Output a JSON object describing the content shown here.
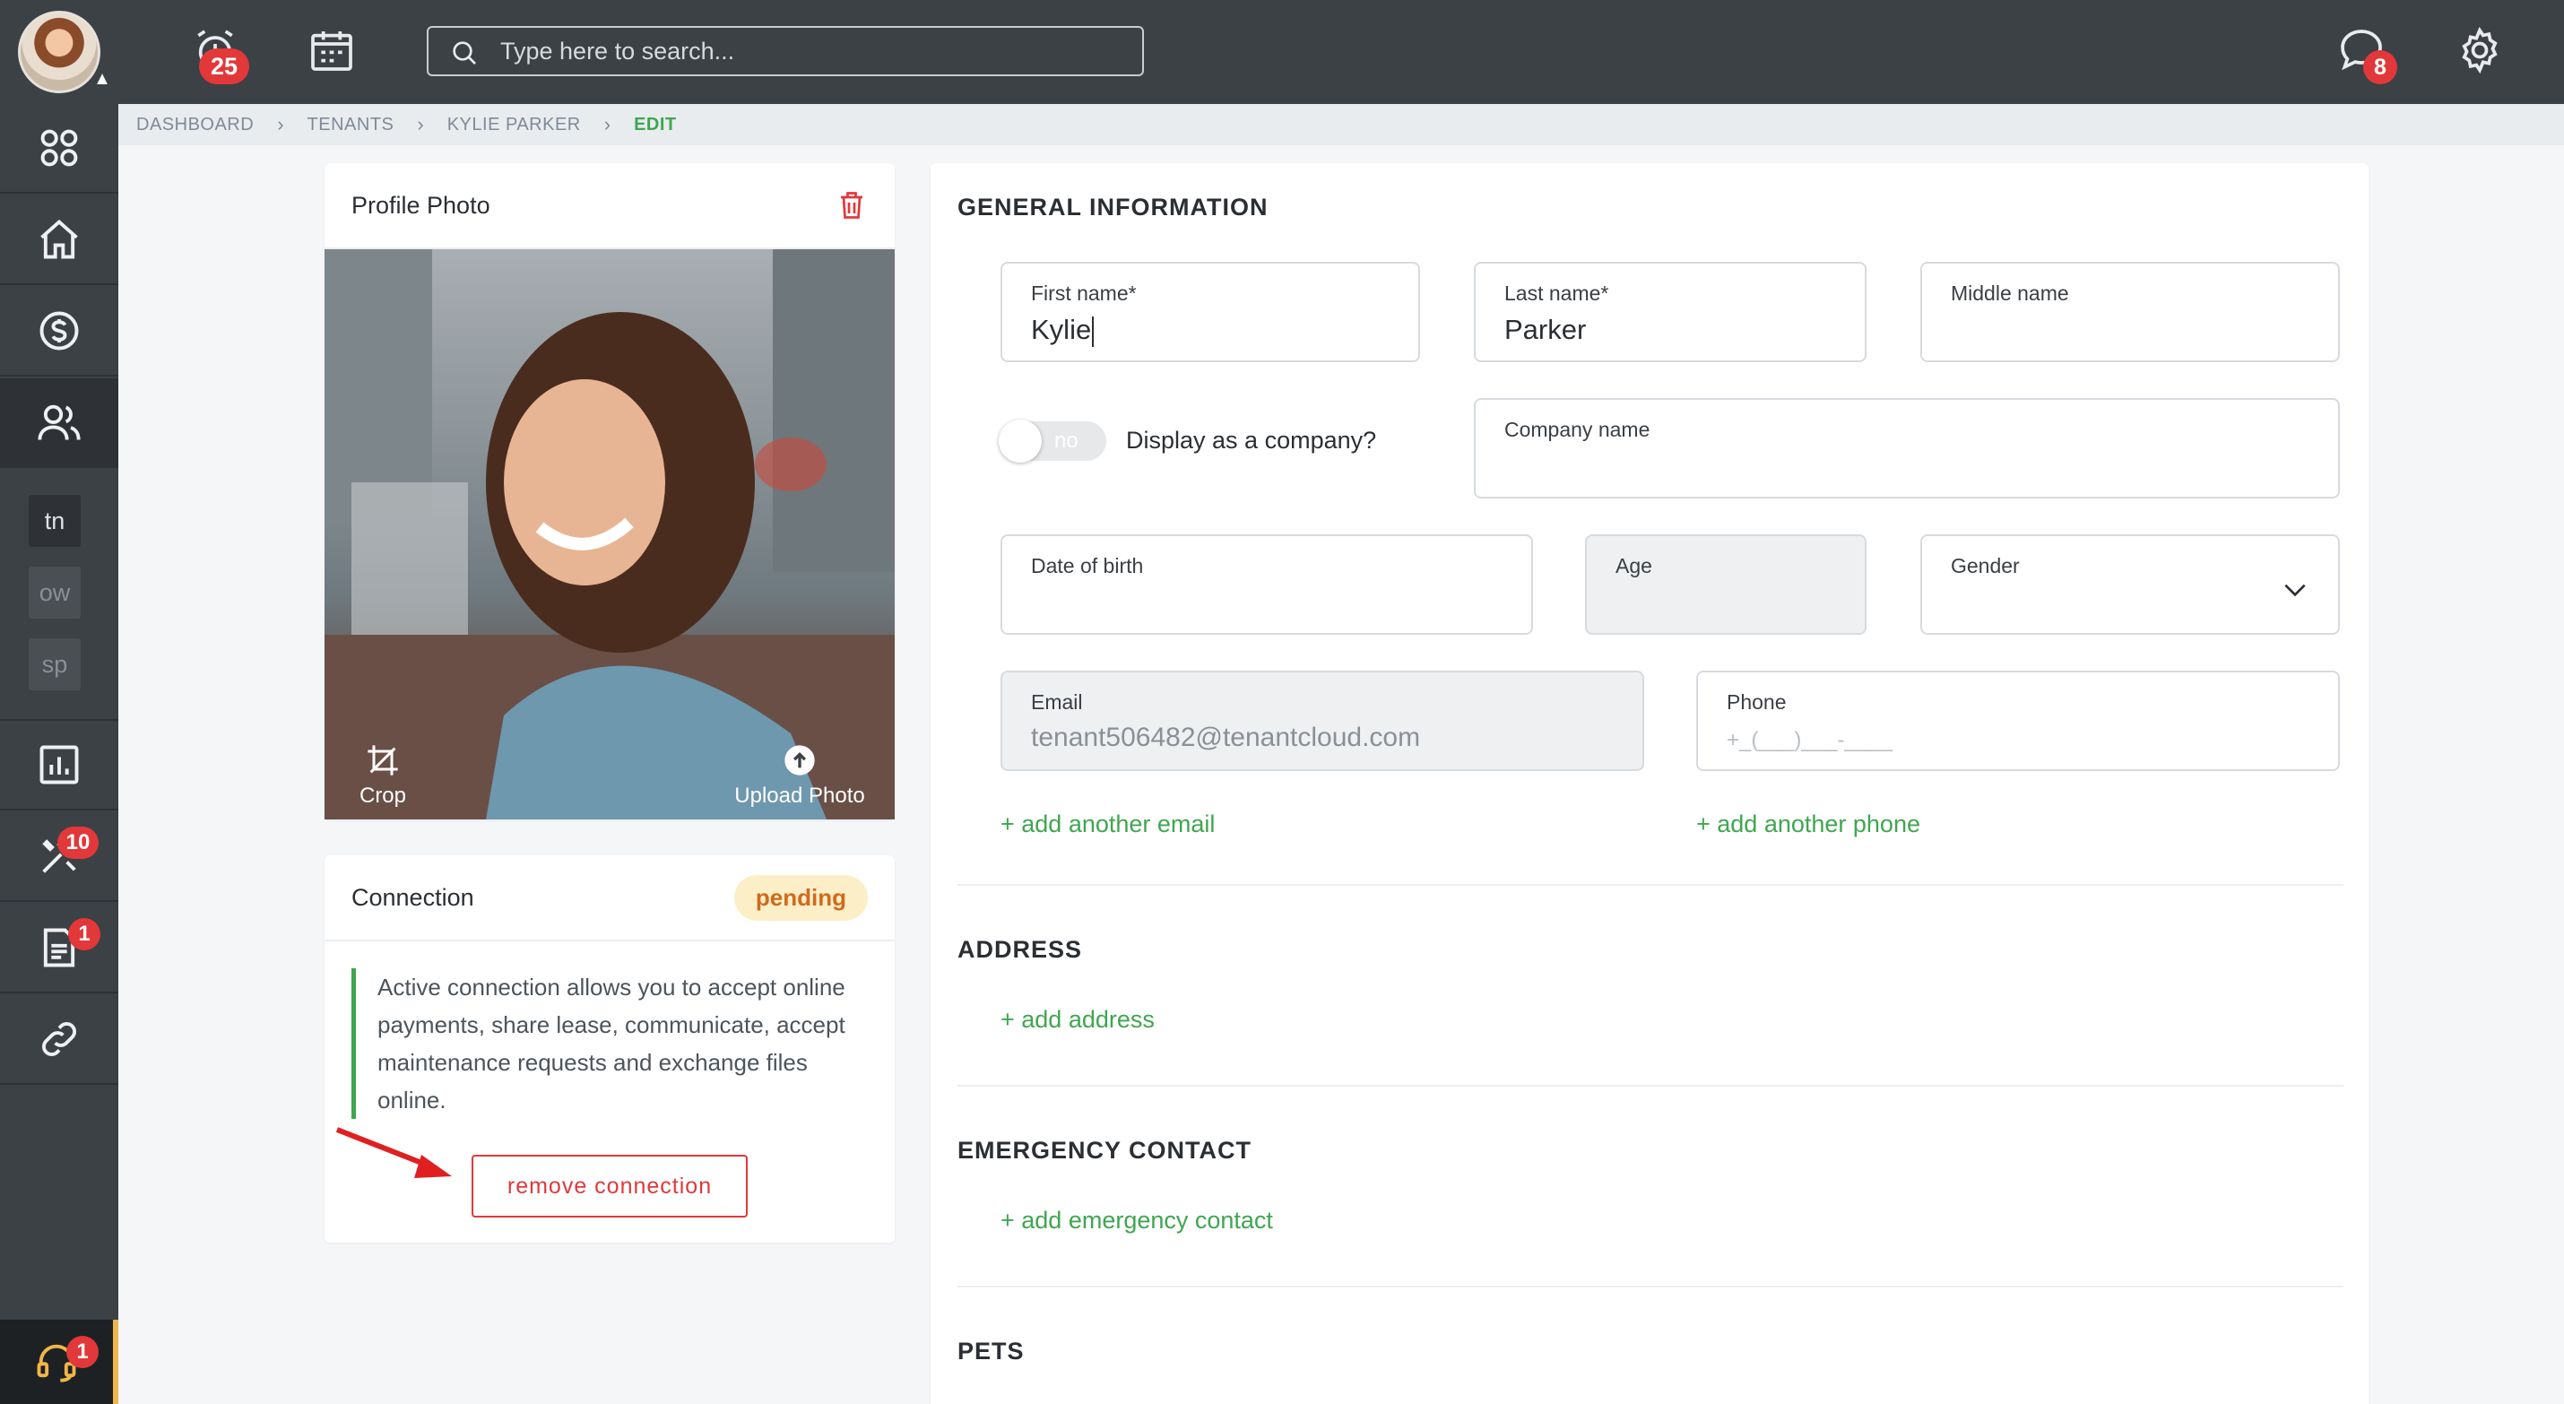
{
  "topbar": {
    "alarm_badge": "25",
    "chat_badge": "8",
    "search_placeholder": "Type here to search..."
  },
  "sidebar": {
    "abbreviations": [
      "tn",
      "ow",
      "sp"
    ],
    "maintenance_badge": "10",
    "documents_badge": "1",
    "support_badge": "1"
  },
  "breadcrumb": [
    "DASHBOARD",
    "TENANTS",
    "KYLIE PARKER",
    "EDIT"
  ],
  "photo_card": {
    "title": "Profile Photo",
    "crop_label": "Crop",
    "upload_label": "Upload Photo"
  },
  "connection_card": {
    "title": "Connection",
    "status": "pending",
    "description": "Active connection allows you to accept online payments, share lease, communicate, accept maintenance requests and exchange files online.",
    "remove_label": "remove connection"
  },
  "general": {
    "title": "GENERAL INFORMATION",
    "first_name_label": "First name*",
    "first_name_value": "Kylie",
    "last_name_label": "Last name*",
    "last_name_value": "Parker",
    "middle_name_label": "Middle name",
    "middle_name_value": "",
    "company_toggle_value": "no",
    "company_toggle_label": "Display as a company?",
    "company_name_label": "Company name",
    "dob_label": "Date of birth",
    "age_label": "Age",
    "gender_label": "Gender",
    "email_label": "Email",
    "email_value": "tenant506482@tenantcloud.com",
    "phone_label": "Phone",
    "phone_mask": "+_(___)___-____",
    "add_email": "+ add another email",
    "add_phone": "+ add another phone"
  },
  "address": {
    "title": "ADDRESS",
    "add_label": "+ add address"
  },
  "emergency": {
    "title": "EMERGENCY CONTACT",
    "add_label": "+ add emergency contact"
  },
  "pets": {
    "title": "PETS"
  },
  "colors": {
    "sidebar": "#3c4146",
    "accent_green": "#3fa650",
    "danger_red": "#e2383a",
    "pending_bg": "#fcefc7"
  }
}
